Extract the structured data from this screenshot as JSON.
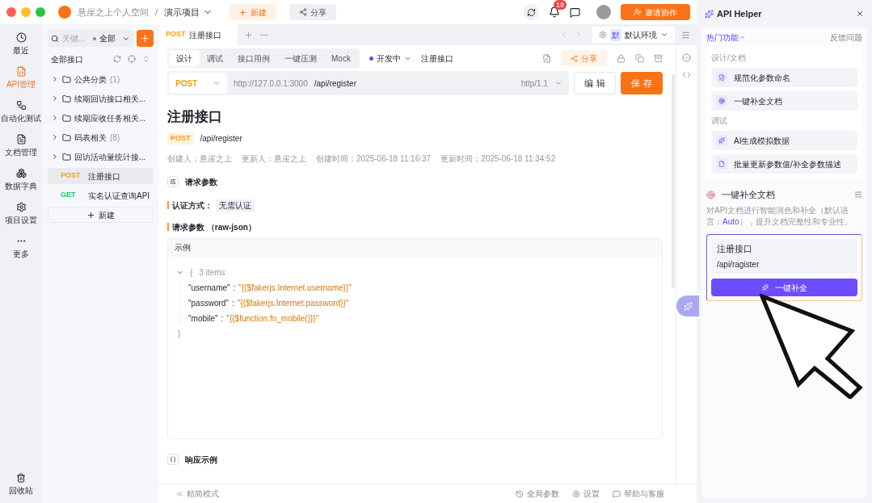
{
  "window": {
    "workspace": "悬崖之上个人空间",
    "separator": "/",
    "project": "演示项目",
    "new_button": "新建",
    "share_button": "分享",
    "notification_count": "19",
    "invite_button": "邀请协作"
  },
  "nav": [
    {
      "kind": "clock",
      "label": "最近",
      "selected": false
    },
    {
      "kind": "api",
      "label": "API管理",
      "selected": true
    },
    {
      "kind": "test",
      "label": "自动化测试",
      "selected": false
    },
    {
      "kind": "doc",
      "label": "文档管理",
      "selected": false
    },
    {
      "kind": "dict",
      "label": "数据字典",
      "selected": false
    },
    {
      "kind": "settings",
      "label": "项目设置",
      "selected": false
    },
    {
      "kind": "more",
      "label": "更多",
      "selected": false
    }
  ],
  "trash": {
    "label": "回收站"
  },
  "tree": {
    "search_placeholder": "关键...",
    "filter": "全部",
    "root": "全部接口",
    "items": [
      {
        "kind": "folder",
        "name": "公共分类",
        "count": "(1)",
        "selected": false
      },
      {
        "kind": "folder",
        "name": "续期回访接口相关...",
        "selected": false
      },
      {
        "kind": "folder",
        "name": "续期应收任务相关...",
        "selected": false
      },
      {
        "kind": "folder",
        "name": "码表相关",
        "count": "(8)",
        "selected": false
      },
      {
        "kind": "folder",
        "name": "回访活动量统计接...",
        "selected": false
      },
      {
        "kind": "api",
        "method": "POST",
        "name": "注册接口",
        "selected": true
      },
      {
        "kind": "api",
        "method": "GET",
        "name": "实名认证查询API",
        "selected": false
      }
    ],
    "new_button": "新建"
  },
  "tabs": [
    {
      "method": "POST",
      "label": "注册接口",
      "selected": true
    }
  ],
  "environment": {
    "badge": "默",
    "name": "默认环境"
  },
  "subtabs": [
    {
      "label": "设计",
      "selected": true
    },
    {
      "label": "调试",
      "selected": false
    },
    {
      "label": "接口用例",
      "selected": false
    },
    {
      "label": "一键压测",
      "selected": false
    },
    {
      "label": "Mock",
      "selected": false
    }
  ],
  "status": {
    "label": "开发中",
    "color": "#5b4ff5"
  },
  "api_name": "注册接口",
  "share_button": "分享",
  "request": {
    "method": "POST",
    "base_url": "http://127.0.0.1:3000",
    "path": "/api/register",
    "protocol": "http/1.1",
    "edit_button": "编 辑",
    "save_button": "保 存"
  },
  "doc": {
    "title": "注册接口",
    "method": "POST",
    "path": "/api/register",
    "meta": [
      "创建人：悬崖之上",
      "更新人：悬崖之上",
      "创建时间：2025-06-18 11:16:37",
      "更新时间：2025-06-18 11:34:52"
    ],
    "params_heading": "请求参数",
    "auth_label": "认证方式：",
    "auth_value": "无需认证",
    "body_heading": "请求参数 （raw-json）",
    "example_tab": "示例",
    "json_open": "{",
    "json_summary": "3 items",
    "json_lines": [
      {
        "key": "\"username\"",
        "sep": ":",
        "value": "\"{{$fakerjs.Internet.username}}\""
      },
      {
        "key": "\"password\"",
        "sep": ":",
        "value": "\"{{$fakerjs.Internet.password}}\""
      },
      {
        "key": "\"mobile\"",
        "sep": ":",
        "value": "\"{{$function.fn_mobile()}}\""
      }
    ],
    "json_close": "}",
    "response_heading": "响应示例"
  },
  "footer": {
    "compact": "精简模式",
    "global_params": "全局参数",
    "settings": "设置",
    "help": "帮助与客服"
  },
  "helper": {
    "title": "API Helper",
    "hot": "热门功能",
    "feedback": "反馈问题",
    "groups": [
      {
        "label": "设计/文档",
        "items": [
          {
            "kind": "rename",
            "label": "规范化参数命名"
          },
          {
            "kind": "target",
            "label": "一键补全文档"
          }
        ]
      },
      {
        "label": "调试",
        "items": [
          {
            "kind": "mock",
            "label": "AI生成模拟数据"
          },
          {
            "kind": "file",
            "label": "批量更新参数值/补全参数描述"
          }
        ]
      }
    ],
    "feature_title": "一键补全文档",
    "desc_before": "对API文档进行智能润色和补全（默认语言：",
    "desc_lang": "Auto",
    "desc_after": "），提升文档完整性和专业性。",
    "card_name": "注册接口",
    "card_path": "/api/ragister",
    "run_button": "一键补全"
  }
}
